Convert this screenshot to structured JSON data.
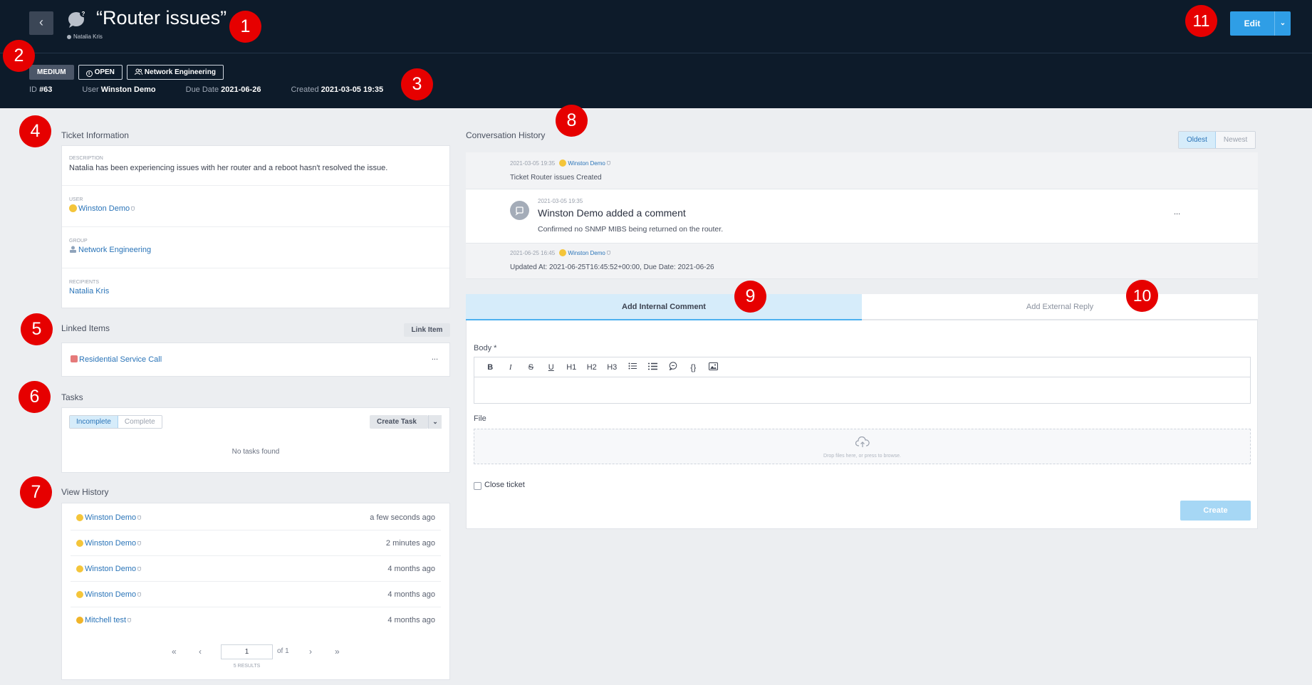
{
  "header": {
    "back_label": "‹",
    "title": "“Router issues”",
    "owner": "Natalia Kris",
    "edit_label": "Edit",
    "edit_caret": "⌄",
    "badges": {
      "priority": "MEDIUM",
      "status": "OPEN",
      "group": "Network Engineering"
    },
    "meta": {
      "id_label": "ID",
      "id_value": "#63",
      "user_label": "User",
      "user_value": "Winston Demo",
      "due_label": "Due Date",
      "due_value": "2021-06-26",
      "created_label": "Created",
      "created_value": "2021-03-05 19:35"
    }
  },
  "ticket_info": {
    "title": "Ticket Information",
    "description_label": "DESCRIPTION",
    "description": "Natalia has been experiencing issues with her router and a reboot hasn't resolved the issue.",
    "user_label": "USER",
    "user": "Winston Demo",
    "group_label": "GROUP",
    "group": "Network Engineering",
    "recipients_label": "RECIPIENTS",
    "recipients": "Natalia Kris"
  },
  "linked_items": {
    "title": "Linked Items",
    "link_button": "Link Item",
    "items": [
      {
        "label": "Residential Service Call",
        "more": "..."
      }
    ]
  },
  "tasks": {
    "title": "Tasks",
    "filter_incomplete": "Incomplete",
    "filter_complete": "Complete",
    "create_button": "Create Task",
    "create_caret": "⌄",
    "empty": "No tasks found"
  },
  "view_history": {
    "title": "View History",
    "rows": [
      {
        "who": "Winston Demo",
        "when": "a few seconds ago"
      },
      {
        "who": "Winston Demo",
        "when": "2 minutes ago"
      },
      {
        "who": "Winston Demo",
        "when": "4 months ago"
      },
      {
        "who": "Winston Demo",
        "when": "4 months ago"
      },
      {
        "who": "Mitchell test",
        "when": "4 months ago"
      }
    ],
    "pager": {
      "first": "«",
      "prev": "‹",
      "page": "1",
      "of": "of 1",
      "next": "›",
      "last": "»",
      "results": "5 RESULTS"
    }
  },
  "conversation": {
    "title": "Conversation History",
    "sort_oldest": "Oldest",
    "sort_newest": "Newest",
    "entries": [
      {
        "time": "2021-03-05 19:35",
        "who": "Winston Demo",
        "text": "Ticket Router issues Created"
      },
      {
        "time": "2021-03-05 19:35",
        "heading": "Winston Demo added a comment",
        "text": "Confirmed no SNMP MIBS being returned on the router.",
        "more": "..."
      },
      {
        "time": "2021-06-25 16:45",
        "who": "Winston Demo",
        "text": "Updated At: 2021-06-25T16:45:52+00:00, Due Date: 2021-06-26"
      }
    ]
  },
  "reply": {
    "tab_internal": "Add Internal Comment",
    "tab_external": "Add External Reply",
    "body_label": "Body *",
    "toolbar": [
      "B",
      "I",
      "S",
      "U",
      "H1",
      "H2",
      "H3",
      "ul",
      "ol",
      "quote",
      "{}",
      "img"
    ],
    "file_label": "File",
    "drop_text": "Drop files here, or press to browse.",
    "close_ticket_label": "Close ticket",
    "create_button": "Create"
  },
  "markers": [
    "1",
    "2",
    "3",
    "4",
    "5",
    "6",
    "7",
    "8",
    "9",
    "10",
    "11"
  ],
  "colors": {
    "header_bg": "#0d1b2a",
    "accent": "#2f9ee6",
    "marker": "#e60000",
    "link": "#2a74b8"
  }
}
